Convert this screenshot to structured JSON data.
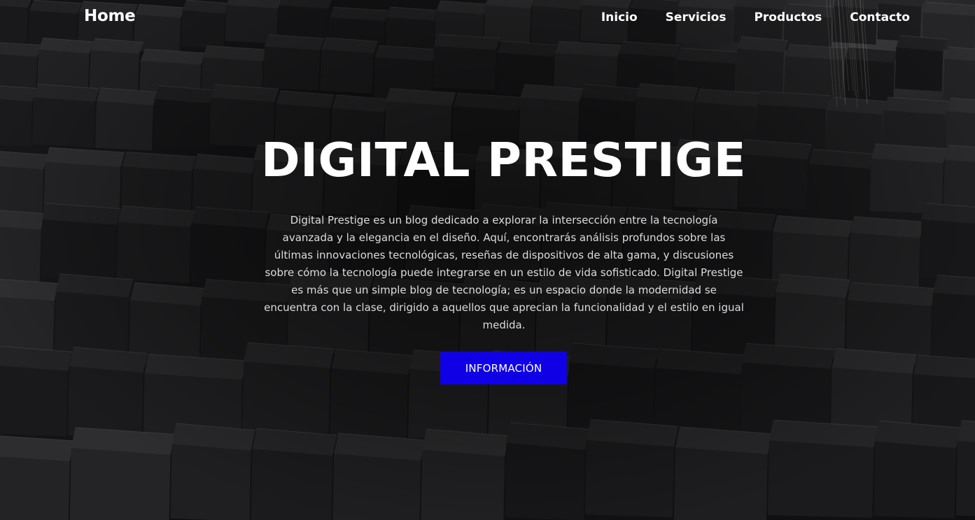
{
  "nav": {
    "brand": "Home",
    "items": [
      {
        "label": "Inicio"
      },
      {
        "label": "Servicios"
      },
      {
        "label": "Productos"
      },
      {
        "label": "Contacto"
      }
    ]
  },
  "hero": {
    "title": "DIGITAL PRESTIGE",
    "description": "Digital Prestige es un blog dedicado a explorar la intersección entre la tecnología avanzada y la elegancia en el diseño. Aquí, encontrarás análisis profundos sobre las últimas innovaciones tecnológicas, reseñas de dispositivos de alta gama, y discusiones sobre cómo la tecnología puede integrarse en un estilo de vida sofisticado. Digital Prestige es más que un simple blog de tecnología; es un espacio donde la modernidad se encuentra con la clase, dirigido a aquellos que aprecian la funcionalidad y el estilo en igual medida.",
    "button_label": "INFORMACIÓN"
  },
  "colors": {
    "button": "#1000e6",
    "text": "#ffffff",
    "background": "#121214"
  }
}
